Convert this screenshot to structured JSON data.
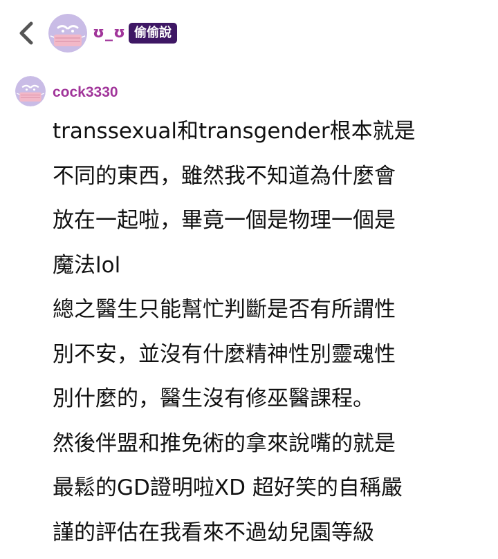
{
  "header": {
    "nickname": "ʊ_ʊ",
    "badge": "偷偷說"
  },
  "comment": {
    "username": "cock3330",
    "lines": [
      "transsexual和transgender根本就是",
      "不同的東西，雖然我不知道為什麼會",
      "放在一起啦，畢竟一個是物理一個是",
      "魔法lol",
      "總之醫生只能幫忙判斷是否有所謂性",
      "別不安，並沒有什麼精神性別靈魂性",
      "別什麼的，醫生沒有修巫醫課程。",
      "然後伴盟和推免術的拿來說嘴的就是",
      "最鬆的GD證明啦XD 超好笑的自稱嚴",
      "謹的評估在我看來不過幼兒園等級"
    ]
  },
  "colors": {
    "accent": "#a1359a",
    "badge_bg": "#3e1764",
    "avatar_bg": "#c9bce6",
    "avatar_mask": "#f2b8c8"
  },
  "icons": {
    "back": "chevron-left-icon",
    "avatar": "masked-face-avatar-icon"
  }
}
